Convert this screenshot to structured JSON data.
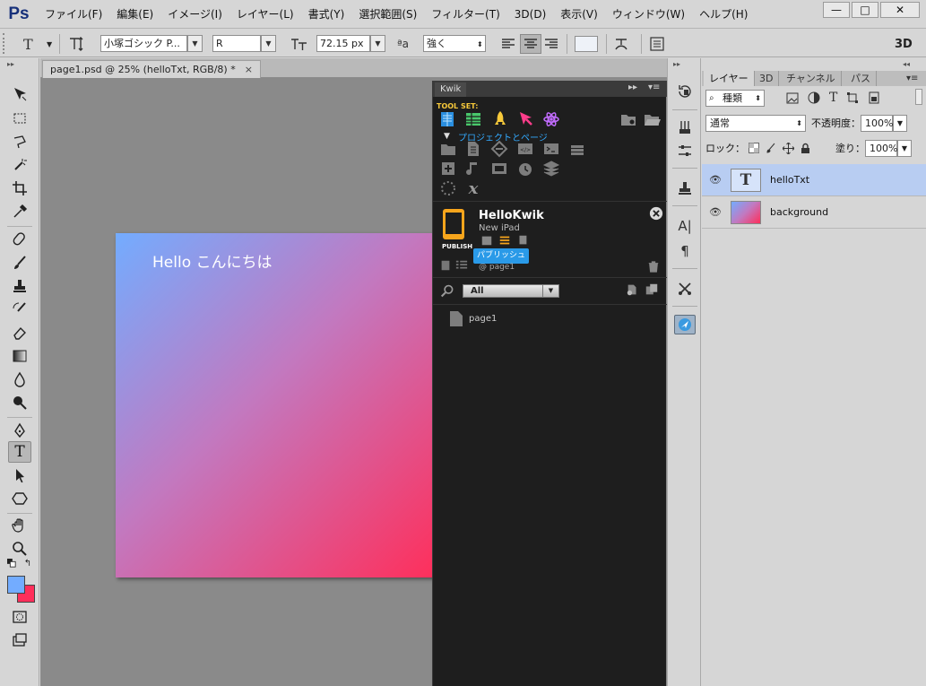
{
  "app": {
    "logo": "Ps",
    "menu": [
      "ファイル(F)",
      "編集(E)",
      "イメージ(I)",
      "レイヤー(L)",
      "書式(Y)",
      "選択範囲(S)",
      "フィルター(T)",
      "3D(D)",
      "表示(V)",
      "ウィンドウ(W)",
      "ヘルプ(H)"
    ],
    "window_controls": {
      "minimize": "—",
      "maximize": "□",
      "close": "✕"
    }
  },
  "options_bar": {
    "tool_glyph": "T",
    "font_family": "小塚ゴシック P...",
    "font_style": "R",
    "font_size": "72.15 px",
    "aa_label": "ªa",
    "antialias": "強く",
    "mode_3d": "3D"
  },
  "document": {
    "tab_title": "page1.psd @ 25% (helloTxt, RGB/8) *",
    "tab_close": "×",
    "canvas_text": "Hello こんにちは",
    "gradient_colors": [
      "#73acff",
      "#c279c0",
      "#ff2e5a"
    ]
  },
  "kwik": {
    "tab": "Kwik",
    "toolset_label": "TOOL SET:",
    "subheader": "プロジェクトとページ",
    "project_name": "HelloKwik",
    "project_device": "New iPad",
    "publish_label": "PUBLISH",
    "tooltip": "パブリッシュ",
    "page_ref": "@ page1",
    "filter_value": "All",
    "pages": [
      "page1"
    ],
    "accent_blue": "#33aaff",
    "accent_yellow": "#f7c93a"
  },
  "layers_panel": {
    "tabs": [
      "レイヤー",
      "3D",
      "チャンネル",
      "パス"
    ],
    "filter_kind": "種類",
    "blend_mode": "通常",
    "opacity_label": "不透明度：",
    "opacity": "100%",
    "lock_label": "ロック：",
    "fill_label": "塗り：",
    "fill": "100%",
    "layers": [
      {
        "name": "helloTxt",
        "type": "text",
        "selected": true
      },
      {
        "name": "background",
        "type": "image",
        "selected": false
      }
    ],
    "selection_color": "#b8cdf2"
  }
}
